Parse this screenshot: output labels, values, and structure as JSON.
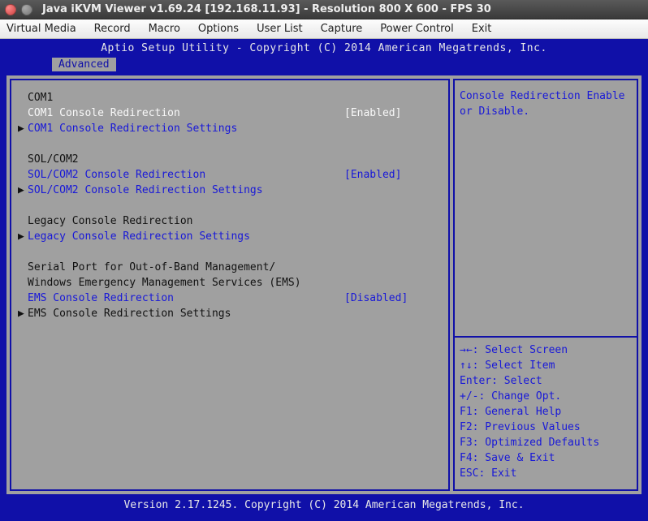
{
  "window": {
    "title": "Java iKVM Viewer v1.69.24 [192.168.11.93]  - Resolution 800 X 600 - FPS 30"
  },
  "menubar": {
    "items": [
      "Virtual Media",
      "Record",
      "Macro",
      "Options",
      "User List",
      "Capture",
      "Power Control",
      "Exit"
    ]
  },
  "bios": {
    "header": "Aptio Setup Utility - Copyright (C) 2014 American Megatrends, Inc.",
    "tab": "Advanced",
    "footer": "Version 2.17.1245. Copyright (C) 2014 American Megatrends, Inc.",
    "help_text": "Console Redirection Enable or Disable.",
    "sections": {
      "com1_header": "COM1",
      "com1_redir_label": "COM1 Console Redirection",
      "com1_redir_val": "[Enabled]",
      "com1_settings": "COM1 Console Redirection Settings",
      "sol_header": "SOL/COM2",
      "sol_redir_label": "SOL/COM2 Console Redirection",
      "sol_redir_val": "[Enabled]",
      "sol_settings": "SOL/COM2 Console Redirection Settings",
      "legacy_header": "Legacy Console Redirection",
      "legacy_settings": "Legacy Console Redirection Settings",
      "serial_line1": "Serial Port for Out-of-Band Management/",
      "serial_line2": "Windows Emergency Management Services (EMS)",
      "ems_redir_label": "EMS Console Redirection",
      "ems_redir_val": "[Disabled]",
      "ems_settings": "EMS Console Redirection Settings"
    },
    "keys": {
      "k1": "→←: Select Screen",
      "k2": "↑↓: Select Item",
      "k3": "Enter: Select",
      "k4": "+/-: Change Opt.",
      "k5": "F1: General Help",
      "k6": "F2: Previous Values",
      "k7": "F3: Optimized Defaults",
      "k8": "F4: Save & Exit",
      "k9": "ESC: Exit"
    }
  }
}
